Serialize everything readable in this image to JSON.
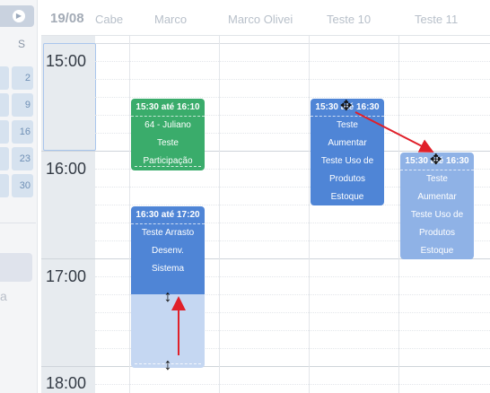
{
  "mini_calendar": {
    "next_icon": "arrow-right-icon",
    "day_header": "S",
    "rows": [
      {
        "left": "",
        "right": "2"
      },
      {
        "left": "",
        "right": "9"
      },
      {
        "left": "",
        "right": "16"
      },
      {
        "left": "",
        "right": "23"
      },
      {
        "left": "",
        "right": "30"
      }
    ],
    "cut_text": "a"
  },
  "header": {
    "date": "19/08",
    "columns": [
      "Cabe",
      "Marco",
      "Marco Olivei",
      "Teste 10",
      "Teste 11"
    ]
  },
  "times": [
    "15:00",
    "16:00",
    "17:00",
    "18:00"
  ],
  "events": {
    "green": {
      "time": "15:30 até 16:10",
      "lines": [
        "64 - Juliano",
        "Teste",
        "Participação"
      ],
      "color": "#3aac6b"
    },
    "blue_resize": {
      "time": "16:30 até 17:20",
      "lines": [
        "Teste Arrasto",
        "Desenv.",
        "Sistema"
      ],
      "color": "#4f85d6"
    },
    "blue_move": {
      "time": "15:30 até 16:30",
      "lines": [
        "Teste",
        "Aumentar",
        "Teste Uso de",
        "Produtos",
        "Estoque"
      ],
      "color": "#4f85d6"
    },
    "ghost_move": {
      "time": "15:30 até 16:30",
      "lines": [
        "Teste",
        "Aumentar",
        "Teste Uso de",
        "Produtos",
        "Estoque"
      ],
      "color": "#8fb2e6"
    }
  },
  "annotation_color": "#e0202a"
}
